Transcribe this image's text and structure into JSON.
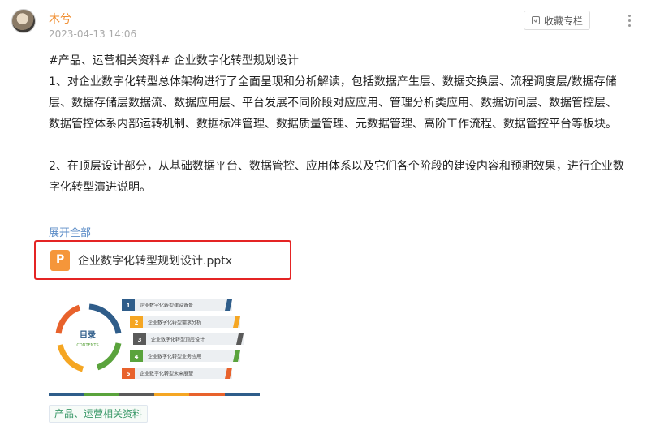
{
  "author": {
    "name": "木兮",
    "time": "2023-04-13 14:06"
  },
  "actions": {
    "favorite_label": "收藏专栏"
  },
  "body": {
    "line1": "#产品、运营相关资料# 企业数字化转型规划设计",
    "para1": "1、对企业数字化转型总体架构进行了全面呈现和分析解读，包括数据产生层、数据交换层、流程调度层/数据存储层、数据存储层数据流、数据应用层、平台发展不同阶段对应应用、管理分析类应用、数据访问层、数据管控层、数据管控体系内部运转机制、数据标准管理、数据质量管理、元数据管理、高阶工作流程、数据管控平台等板块。",
    "para2": "2、在顶层设计部分，从基础数据平台、数据管控、应用体系以及它们各个阶段的建设内容和预期效果，进行企业数字化转型演进说明。"
  },
  "expand_label": "展开全部",
  "attachment": {
    "file_name": "企业数字化转型规划设计.pptx",
    "icon": "ppt-file-icon"
  },
  "thumbnail": {
    "toc_title": "目录",
    "toc_subtitle": "CONTENTS",
    "items": [
      {
        "num": "1",
        "label": "企业数字化转型建设背景",
        "color": "#2f5d8a"
      },
      {
        "num": "2",
        "label": "企业数字化转型需求分析",
        "color": "#f5a623"
      },
      {
        "num": "3",
        "label": "企业数字化转型顶层设计",
        "color": "#5a5a5a"
      },
      {
        "num": "4",
        "label": "企业数字化转型业务应用",
        "color": "#5aa33c"
      },
      {
        "num": "5",
        "label": "企业数字化转型未来展望",
        "color": "#e8622c"
      }
    ],
    "bar_colors": [
      "#2f5d8a",
      "#5aa33c",
      "#5a5a5a",
      "#f5a623",
      "#e8622c",
      "#2f5d8a"
    ]
  },
  "tag_label": "产品、运营相关资料"
}
